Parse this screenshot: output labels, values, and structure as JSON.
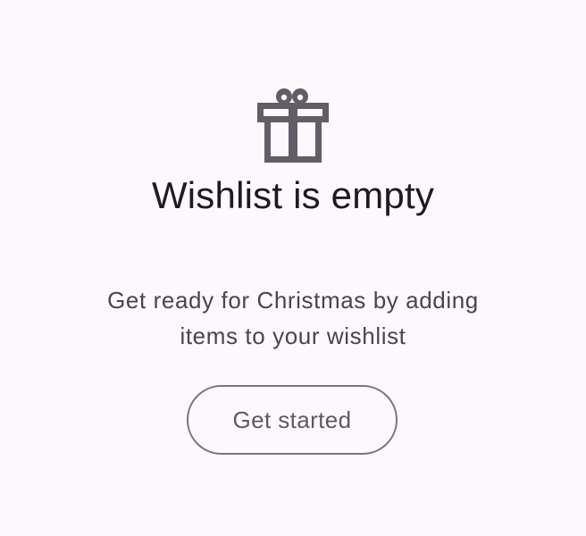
{
  "empty_state": {
    "icon": "gift-icon",
    "title": "Wishlist is empty",
    "subtitle": "Get ready for Christmas by adding items to your wishlist",
    "button_label": "Get started"
  },
  "colors": {
    "background": "#fdf8fc",
    "icon": "#625d66",
    "title": "#1d1b20",
    "subtitle": "#49454f",
    "button_border": "#79747e",
    "button_text": "#5d5a63"
  }
}
